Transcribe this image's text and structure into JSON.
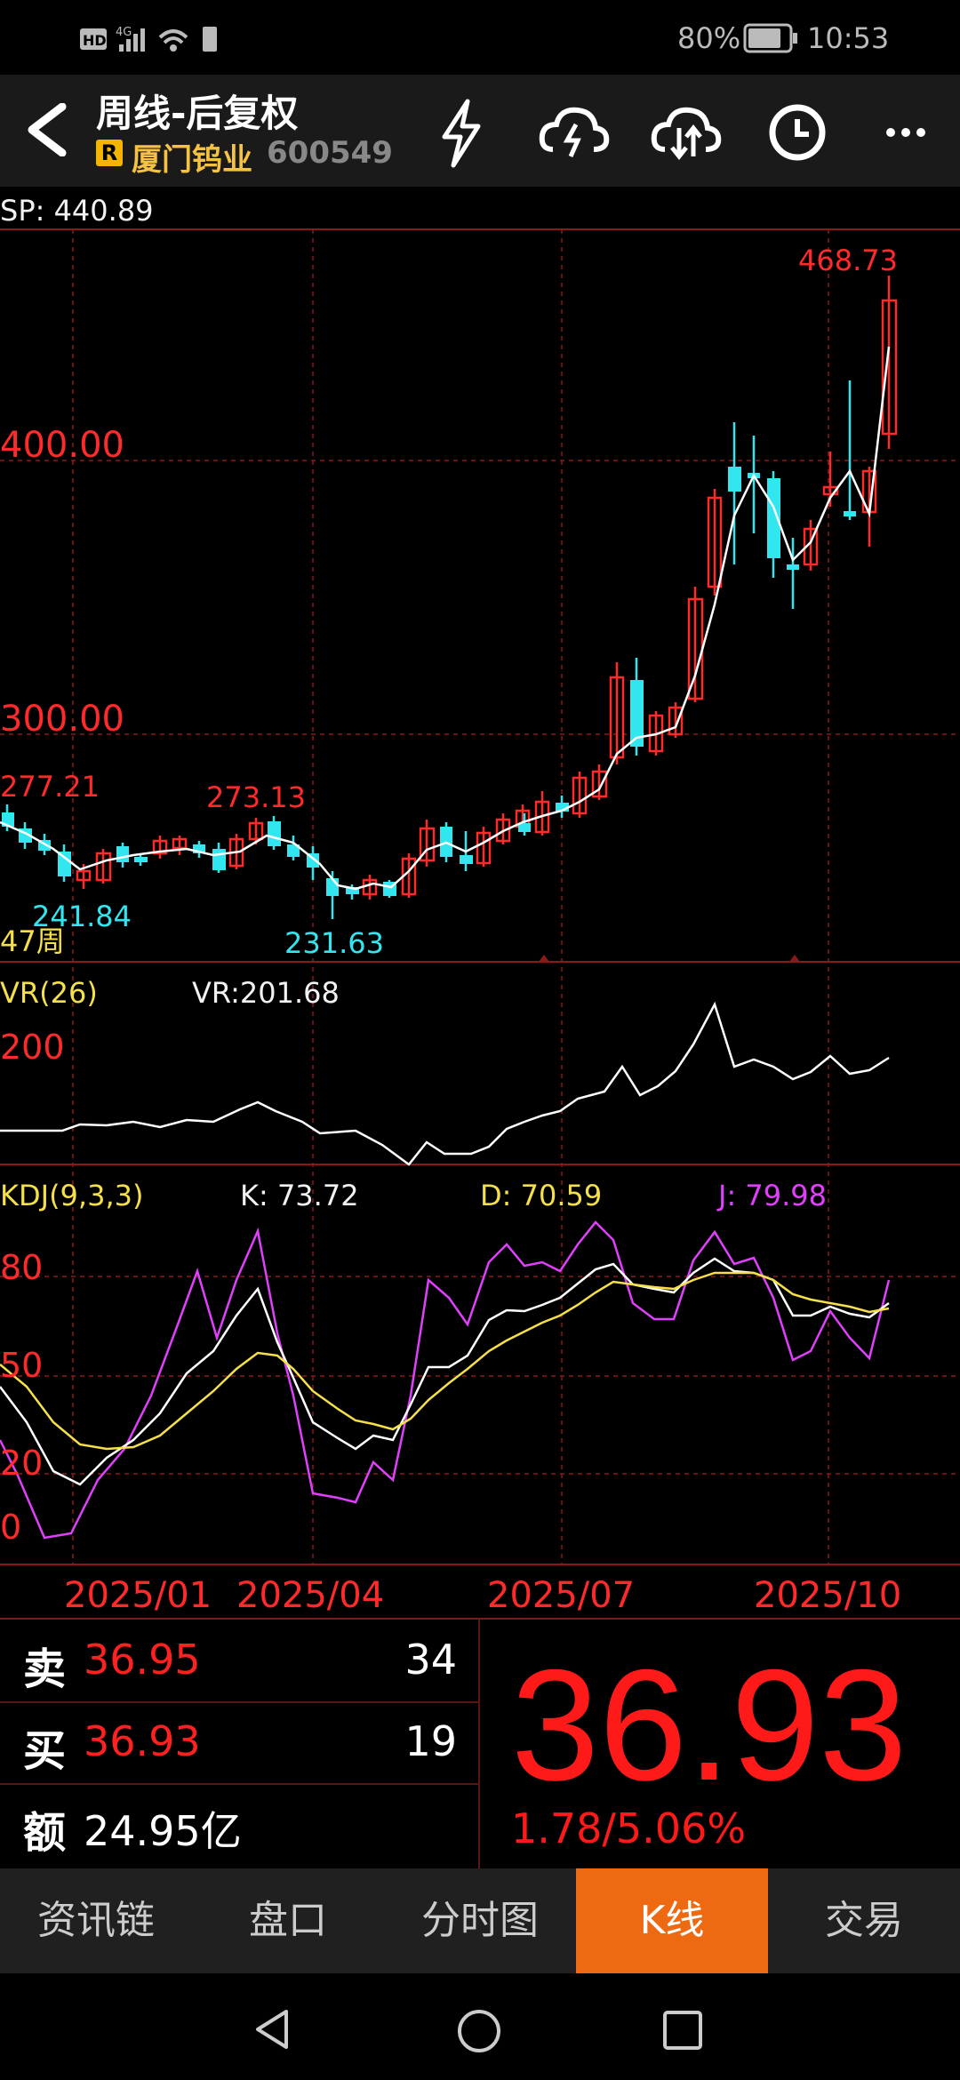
{
  "status_bar": {
    "left_icons": [
      "hd-icon",
      "4g-signal-icon",
      "wifi-icon",
      "sim-icon"
    ],
    "battery": "80%",
    "time": "10:53"
  },
  "header": {
    "title": "周线-后复权",
    "badge": "R",
    "stock_name": "厦门钨业",
    "stock_code": "600549",
    "icons": [
      "flash-icon",
      "cloud-upload-icon",
      "cloud-download-icon",
      "clock-icon",
      "more-icon"
    ]
  },
  "kline": {
    "sp_label": "SP: 440.89",
    "y_labels": [
      "400.00",
      "300.00"
    ],
    "annotations": [
      "468.73",
      "277.21",
      "273.13",
      "241.84",
      "231.63"
    ],
    "period_label": "47周"
  },
  "vr": {
    "name": "VR(26)",
    "value": "VR:201.68",
    "y_label": "200"
  },
  "kdj": {
    "name": "KDJ(9,3,3)",
    "k": "K: 73.72",
    "d": "D: 70.59",
    "j": "J: 79.98",
    "y_labels": [
      "80",
      "50",
      "20",
      "0"
    ]
  },
  "x_axis": [
    "2025/01",
    "2025/04",
    "2025/07",
    "2025/10"
  ],
  "quote": {
    "sell_label": "卖",
    "sell_price": "36.95",
    "sell_qty": "34",
    "buy_label": "买",
    "buy_price": "36.93",
    "buy_qty": "19",
    "amount_label": "额",
    "amount_value": "24.95亿",
    "price": "36.93",
    "change": "1.78/5.06%"
  },
  "tabs": [
    "资讯链",
    "盘口",
    "分时图",
    "K线",
    "交易"
  ],
  "active_tab": "K线",
  "colors": {
    "up": "#ff2a2a",
    "down": "#32e6f0",
    "accent": "#ee6a12",
    "ma": "#ffffff"
  }
}
